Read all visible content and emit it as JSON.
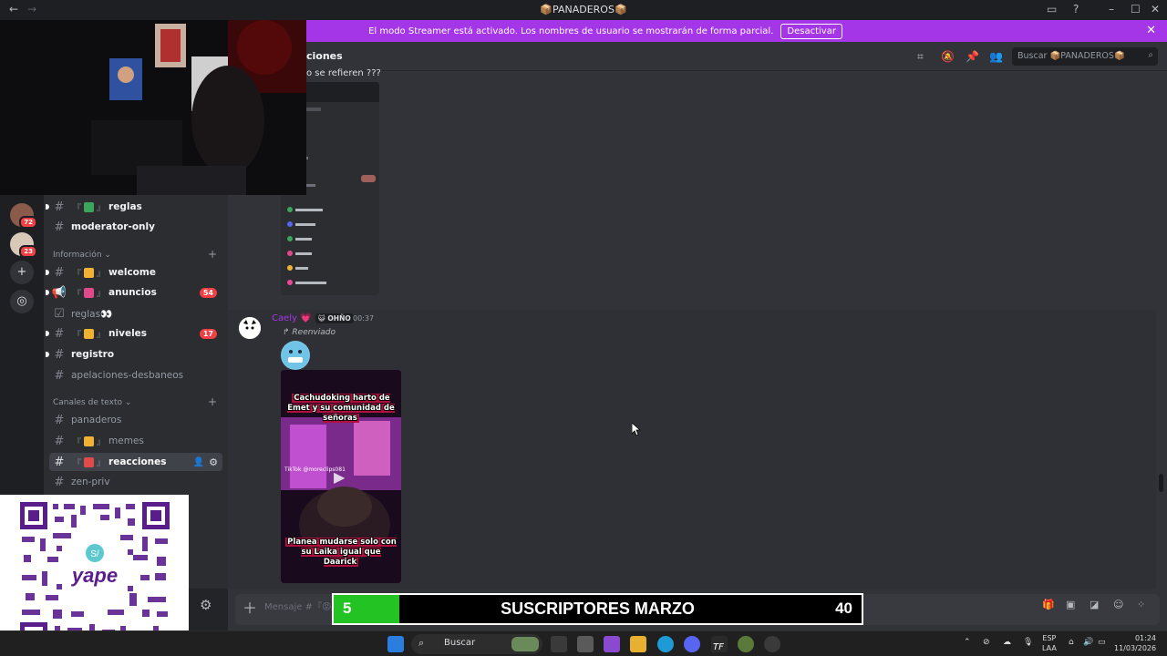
{
  "window": {
    "title": "📦PANADEROS📦",
    "back": "←",
    "forward": "→"
  },
  "banner": {
    "text": "El modo Streamer está activado. Los nombres de usuario se mostrarán de forma parcial.",
    "button": "Desactivar",
    "close": "✕"
  },
  "servers": [
    {
      "badge": "72"
    },
    {
      "badge": "23"
    }
  ],
  "sidebar": {
    "categories": [
      {
        "label": "Información ⌄"
      },
      {
        "label": "Canales de texto ⌄"
      }
    ],
    "channels": [
      {
        "prefix": "『",
        "suffix": "』",
        "name": "reglas",
        "emoji_color": "#3ba55d",
        "state": "unread"
      },
      {
        "name": "moderator-only",
        "state": "unread"
      },
      {
        "prefix": "『",
        "suffix": "』",
        "name": "welcome",
        "emoji_color": "#f0b232",
        "state": "unread"
      },
      {
        "prefix": "『",
        "suffix": "』",
        "name": "anuncios",
        "emoji_color": "#e04a8a",
        "state": "unread",
        "mention": "54"
      },
      {
        "name": "reglas👀",
        "state": "read"
      },
      {
        "prefix": "『",
        "suffix": "』",
        "name": "niveles",
        "emoji_color": "#f0b232",
        "state": "unread",
        "mention": "17"
      },
      {
        "name": "registro",
        "state": "unread"
      },
      {
        "name": "apelaciones-desbaneos",
        "state": "read"
      },
      {
        "name": "panaderos",
        "state": "read"
      },
      {
        "prefix": "『",
        "suffix": "』",
        "name": "memes",
        "emoji_color": "#f0b232",
        "state": "read"
      },
      {
        "prefix": "『",
        "suffix": "』",
        "name": "reacciones",
        "emoji_color": "#e04a4a",
        "state": "active"
      },
      {
        "name": "zen-priv",
        "state": "read"
      }
    ]
  },
  "header": {
    "channel_name": "ciones",
    "search_placeholder": "Buscar 📦PANADEROS📦"
  },
  "chat": {
    "partial_text": "o se refieren ???",
    "message": {
      "author": "Caely 💗",
      "tag": "😺 OHÑO",
      "time": "00:37",
      "forwarded": "↱ Reenviado",
      "video_caption_top": "Cachudoking harto de Emet y su comunidad de señoras",
      "video_caption_bottom": "Planea mudarse solo con su Laika igual que Daarick",
      "video_watermark": "TikTok @moreclips081"
    }
  },
  "composer": {
    "placeholder": "Mensaje #『😡』"
  },
  "subscriber_goal": {
    "current": "5",
    "label": "SUSCRIPTORES MARZO",
    "goal": "40",
    "progress": 0.125
  },
  "taskbar": {
    "search": "Buscar",
    "lang_top": "ESP",
    "lang_bottom": "LAA",
    "time": "01:24",
    "date": "11/03/2026"
  },
  "colors": {
    "banner": "#a536e8",
    "accent": "#5865f2",
    "mention": "#f23f43",
    "progress": "#22c322"
  }
}
